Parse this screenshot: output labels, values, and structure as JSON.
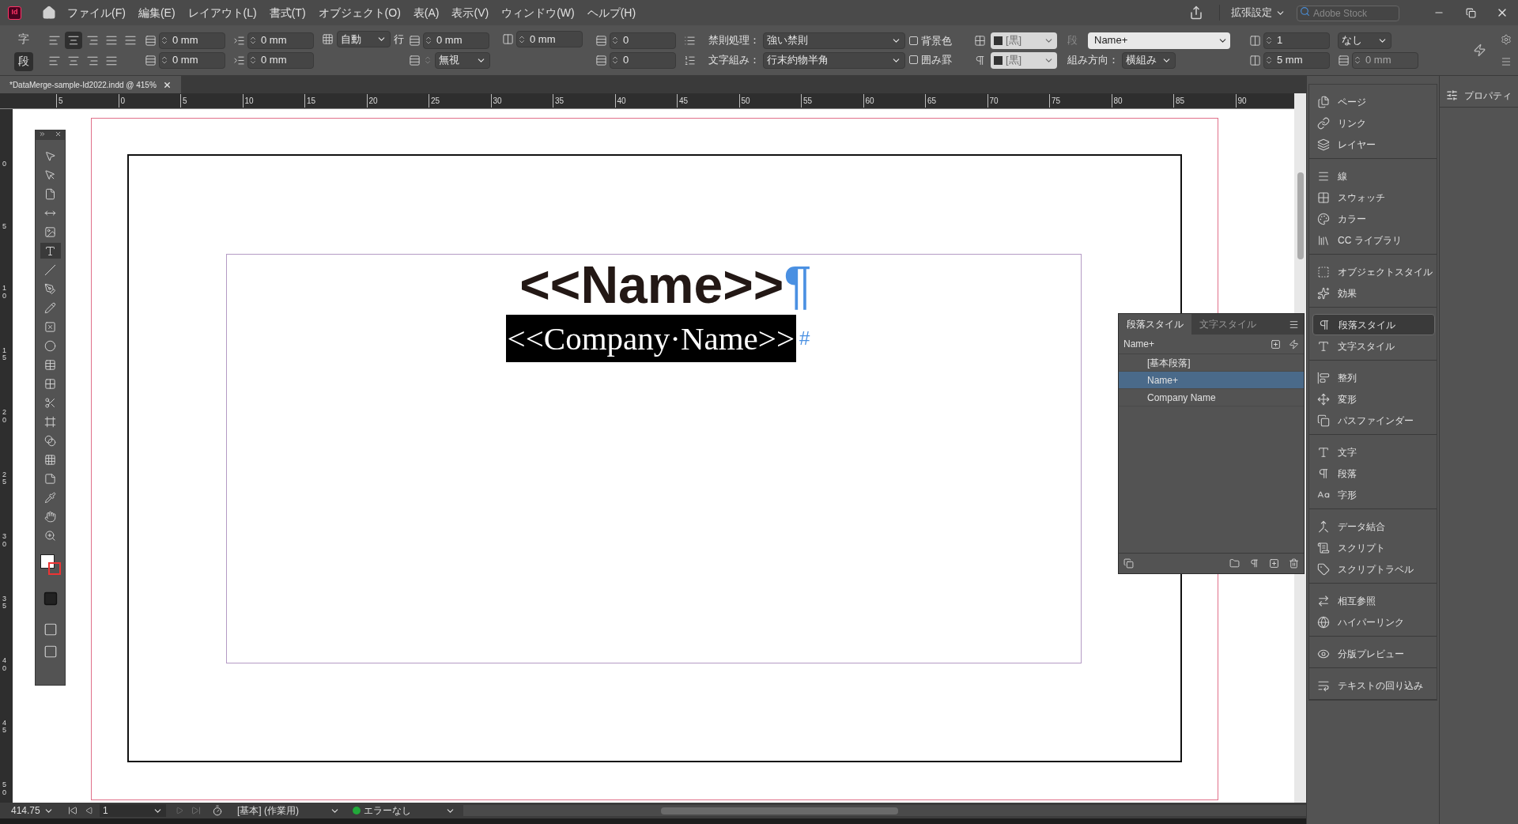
{
  "logo": "Id",
  "menu_bar": {
    "items": [
      "ファイル(F)",
      "編集(E)",
      "レイアウト(L)",
      "書式(T)",
      "オブジェクト(O)",
      "表(A)",
      "表示(V)",
      "ウィンドウ(W)",
      "ヘルプ(H)"
    ],
    "workspace": "拡張設定",
    "search": {
      "placeholder": "Adobe Stock"
    }
  },
  "control_panel": {
    "columns": [
      {
        "top": {
          "kind": "mode",
          "label": "字",
          "selected": false
        },
        "bottom": {
          "kind": "mode",
          "label": "段",
          "selected": true
        }
      },
      {
        "top": {
          "kind": "align",
          "buttons": [
            {
              "selected": false
            },
            {
              "selected": true
            },
            {
              "selected": false
            },
            {
              "selected": false
            },
            {
              "selected": false
            }
          ]
        },
        "bottom": {
          "kind": "align",
          "buttons": [
            {
              "selected": false
            },
            {
              "selected": false
            },
            {
              "selected": false
            },
            {
              "selected": false
            }
          ]
        }
      },
      {
        "top": {
          "kind": "spinner",
          "value": "0 mm",
          "disabled": false
        },
        "bottom": {
          "kind": "spinner",
          "value": "0 mm",
          "disabled": false
        }
      },
      {
        "top": {
          "kind": "spinner",
          "value": "0 mm",
          "disabled": false
        },
        "bottom": {
          "kind": "spinner",
          "value": "0 mm",
          "disabled": false
        }
      },
      {
        "top": {
          "kind": "dropdown",
          "value": "自動",
          "suffix": "行"
        }
      },
      {
        "top": {
          "kind": "spinner",
          "value": "0 mm",
          "disabled": false
        },
        "bottom": {
          "kind": "spin_dropdown",
          "value": "無視"
        }
      },
      {
        "top": {
          "kind": "spinner",
          "value": "0 mm",
          "disabled": false
        }
      },
      {
        "top": {
          "kind": "spinner",
          "value": "0",
          "disabled": false
        },
        "bottom": {
          "kind": "spinner",
          "value": "0",
          "disabled": false
        }
      },
      {
        "top": {
          "kind": "dropdown",
          "label": "禁則処理：",
          "value": "強い禁則"
        },
        "bottom": {
          "kind": "dropdown",
          "label": "文字組み：",
          "value": "行末約物半角"
        }
      },
      {
        "top": {
          "kind": "checkbox",
          "label": "背景色",
          "checked": false
        },
        "bottom": {
          "kind": "checkbox",
          "label": "囲み罫",
          "checked": false
        }
      },
      {
        "top": {
          "kind": "swatch",
          "value": "[黒]"
        },
        "bottom": {
          "kind": "swatch",
          "value": "[黒]"
        }
      },
      {
        "top": {
          "kind": "style",
          "label": "段",
          "value": "Name+"
        },
        "bottom": {
          "kind": "dropdown",
          "label": "組み方向：",
          "value": "横組み"
        }
      },
      {
        "top": {
          "kind": "spinner",
          "value": "1",
          "disabled": false
        },
        "bottom": {
          "kind": "spinner",
          "value": "5 mm",
          "disabled": false
        }
      },
      {
        "top": {
          "kind": "dropdown",
          "value": "なし"
        },
        "bottom": {
          "kind": "spinner",
          "value": "0 mm",
          "disabled": true
        }
      }
    ]
  },
  "document_tab": {
    "title": "*DataMerge-sample-Id2022.indd @ 415%"
  },
  "ruler": {
    "horizontal": [
      "5",
      "0",
      "5",
      "10",
      "15",
      "20",
      "25",
      "30",
      "35",
      "40",
      "45",
      "50",
      "55",
      "60",
      "65",
      "70",
      "75",
      "80",
      "85",
      "90"
    ],
    "vertical": [
      "0",
      "5",
      "10",
      "15",
      "20",
      "25",
      "30",
      "35",
      "40",
      "45",
      "50"
    ]
  },
  "page": {
    "name_field": "<<Name>>",
    "name_mark": "¶",
    "company_field": "<<Company·Name>>",
    "company_mark": "#"
  },
  "paragraph_styles_panel": {
    "tabs": [
      {
        "label": "段落スタイル",
        "selected": true
      },
      {
        "label": "文字スタイル",
        "selected": false
      }
    ],
    "current": "Name+",
    "items": [
      {
        "label": "[基本段落]",
        "selected": false
      },
      {
        "label": "Name+",
        "selected": true
      },
      {
        "label": "Company Name",
        "selected": false
      }
    ]
  },
  "dock": {
    "groups": [
      [
        {
          "label": "ページ",
          "selected": false
        },
        {
          "label": "リンク",
          "selected": false
        },
        {
          "label": "レイヤー",
          "selected": false
        }
      ],
      [
        {
          "label": "線",
          "selected": false
        },
        {
          "label": "スウォッチ",
          "selected": false
        },
        {
          "label": "カラー",
          "selected": false
        },
        {
          "label": "CC ライブラリ",
          "selected": false
        }
      ],
      [
        {
          "label": "オブジェクトスタイル",
          "selected": false
        },
        {
          "label": "効果",
          "selected": false
        }
      ],
      [
        {
          "label": "段落スタイル",
          "selected": true
        },
        {
          "label": "文字スタイル",
          "selected": false
        }
      ],
      [
        {
          "label": "整列",
          "selected": false
        },
        {
          "label": "変形",
          "selected": false
        },
        {
          "label": "パスファインダー",
          "selected": false
        }
      ],
      [
        {
          "label": "文字",
          "selected": false
        },
        {
          "label": "段落",
          "selected": false
        },
        {
          "label": "字形",
          "selected": false
        }
      ],
      [
        {
          "label": "データ結合",
          "selected": false
        },
        {
          "label": "スクリプト",
          "selected": false
        },
        {
          "label": "スクリプトラベル",
          "selected": false
        }
      ],
      [
        {
          "label": "相互参照",
          "selected": false
        },
        {
          "label": "ハイパーリンク",
          "selected": false
        }
      ],
      [
        {
          "label": "分版プレビュー",
          "selected": false
        }
      ],
      [
        {
          "label": "テキストの回り込み",
          "selected": false
        }
      ]
    ],
    "properties": "プロパティ"
  },
  "status_bar": {
    "zoom": "414.75",
    "page": "1",
    "profile": "[基本] (作業用)",
    "preflight": "エラーなし"
  }
}
